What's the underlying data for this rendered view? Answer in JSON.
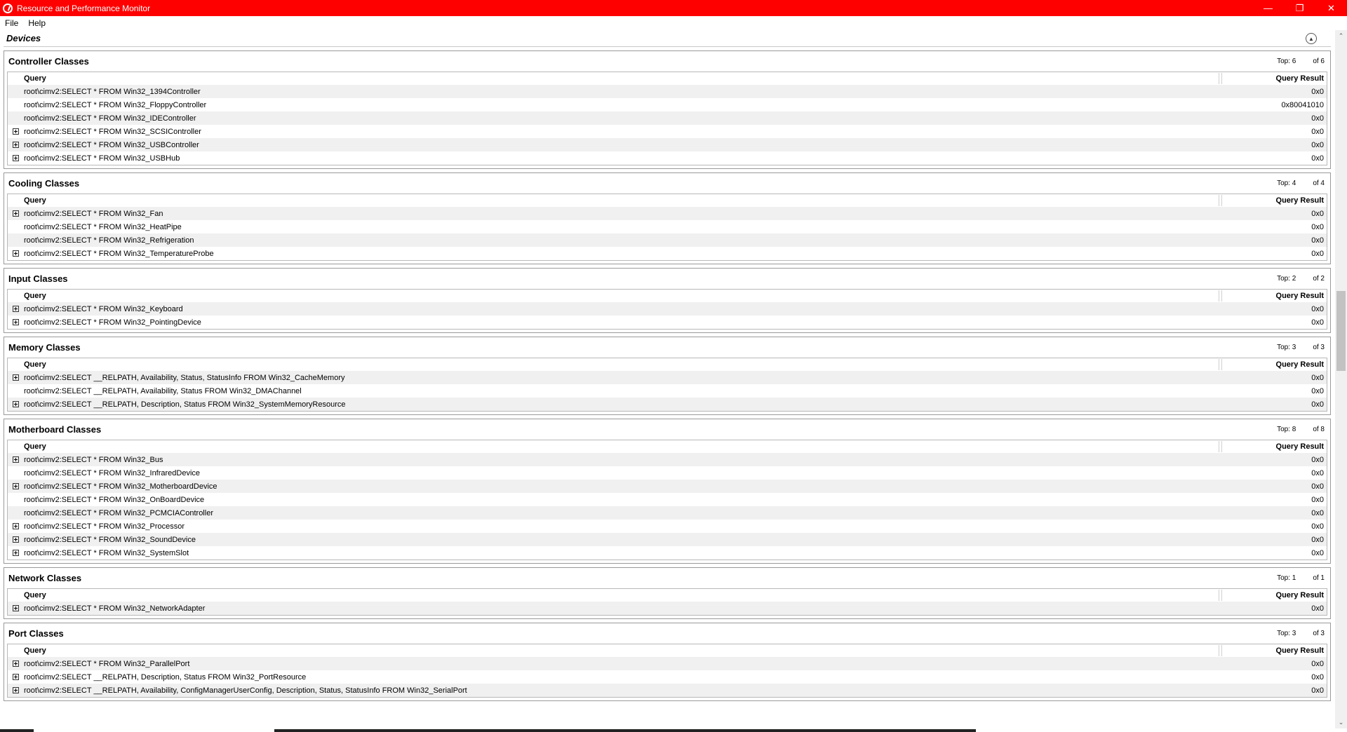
{
  "window": {
    "title": "Resource and Performance Monitor"
  },
  "menu": [
    "File",
    "Help"
  ],
  "devices_header": "Devices",
  "column_headers": {
    "query": "Query",
    "result": "Query Result"
  },
  "sections": [
    {
      "title": "Controller Classes",
      "top": "Top: 6",
      "of": "of 6",
      "rows": [
        {
          "expand": false,
          "query": "root\\cimv2:SELECT * FROM Win32_1394Controller",
          "result": "0x0"
        },
        {
          "expand": false,
          "query": "root\\cimv2:SELECT * FROM Win32_FloppyController",
          "result": "0x80041010"
        },
        {
          "expand": false,
          "query": "root\\cimv2:SELECT * FROM Win32_IDEController",
          "result": "0x0"
        },
        {
          "expand": true,
          "query": "root\\cimv2:SELECT * FROM Win32_SCSIController",
          "result": "0x0"
        },
        {
          "expand": true,
          "query": "root\\cimv2:SELECT * FROM Win32_USBController",
          "result": "0x0"
        },
        {
          "expand": true,
          "query": "root\\cimv2:SELECT * FROM Win32_USBHub",
          "result": "0x0"
        }
      ]
    },
    {
      "title": "Cooling Classes",
      "top": "Top: 4",
      "of": "of 4",
      "rows": [
        {
          "expand": true,
          "query": "root\\cimv2:SELECT * FROM Win32_Fan",
          "result": "0x0"
        },
        {
          "expand": false,
          "query": "root\\cimv2:SELECT * FROM Win32_HeatPipe",
          "result": "0x0"
        },
        {
          "expand": false,
          "query": "root\\cimv2:SELECT * FROM Win32_Refrigeration",
          "result": "0x0"
        },
        {
          "expand": true,
          "query": "root\\cimv2:SELECT * FROM Win32_TemperatureProbe",
          "result": "0x0"
        }
      ]
    },
    {
      "title": "Input Classes",
      "top": "Top: 2",
      "of": "of 2",
      "rows": [
        {
          "expand": true,
          "query": "root\\cimv2:SELECT * FROM Win32_Keyboard",
          "result": "0x0"
        },
        {
          "expand": true,
          "query": "root\\cimv2:SELECT * FROM Win32_PointingDevice",
          "result": "0x0"
        }
      ]
    },
    {
      "title": "Memory Classes",
      "top": "Top: 3",
      "of": "of 3",
      "rows": [
        {
          "expand": true,
          "query": "root\\cimv2:SELECT __RELPATH, Availability, Status, StatusInfo FROM Win32_CacheMemory",
          "result": "0x0"
        },
        {
          "expand": false,
          "query": "root\\cimv2:SELECT __RELPATH, Availability, Status FROM Win32_DMAChannel",
          "result": "0x0"
        },
        {
          "expand": true,
          "query": "root\\cimv2:SELECT __RELPATH, Description, Status FROM Win32_SystemMemoryResource",
          "result": "0x0"
        }
      ]
    },
    {
      "title": "Motherboard Classes",
      "top": "Top: 8",
      "of": "of 8",
      "rows": [
        {
          "expand": true,
          "query": "root\\cimv2:SELECT * FROM Win32_Bus",
          "result": "0x0"
        },
        {
          "expand": false,
          "query": "root\\cimv2:SELECT * FROM Win32_InfraredDevice",
          "result": "0x0"
        },
        {
          "expand": true,
          "query": "root\\cimv2:SELECT * FROM Win32_MotherboardDevice",
          "result": "0x0"
        },
        {
          "expand": false,
          "query": "root\\cimv2:SELECT * FROM Win32_OnBoardDevice",
          "result": "0x0"
        },
        {
          "expand": false,
          "query": "root\\cimv2:SELECT * FROM Win32_PCMCIAController",
          "result": "0x0"
        },
        {
          "expand": true,
          "query": "root\\cimv2:SELECT * FROM Win32_Processor",
          "result": "0x0"
        },
        {
          "expand": true,
          "query": "root\\cimv2:SELECT * FROM Win32_SoundDevice",
          "result": "0x0"
        },
        {
          "expand": true,
          "query": "root\\cimv2:SELECT * FROM Win32_SystemSlot",
          "result": "0x0"
        }
      ]
    },
    {
      "title": "Network Classes",
      "top": "Top: 1",
      "of": "of 1",
      "rows": [
        {
          "expand": true,
          "query": "root\\cimv2:SELECT * FROM Win32_NetworkAdapter",
          "result": "0x0"
        }
      ]
    },
    {
      "title": "Port Classes",
      "top": "Top: 3",
      "of": "of 3",
      "rows": [
        {
          "expand": true,
          "query": "root\\cimv2:SELECT * FROM Win32_ParallelPort",
          "result": "0x0"
        },
        {
          "expand": true,
          "query": "root\\cimv2:SELECT __RELPATH, Description, Status FROM Win32_PortResource",
          "result": "0x0"
        },
        {
          "expand": true,
          "query": "root\\cimv2:SELECT __RELPATH, Availability, ConfigManagerUserConfig, Description, Status, StatusInfo FROM Win32_SerialPort",
          "result": "0x0"
        }
      ]
    }
  ],
  "colors": {
    "titlebar": "#ff0000"
  }
}
